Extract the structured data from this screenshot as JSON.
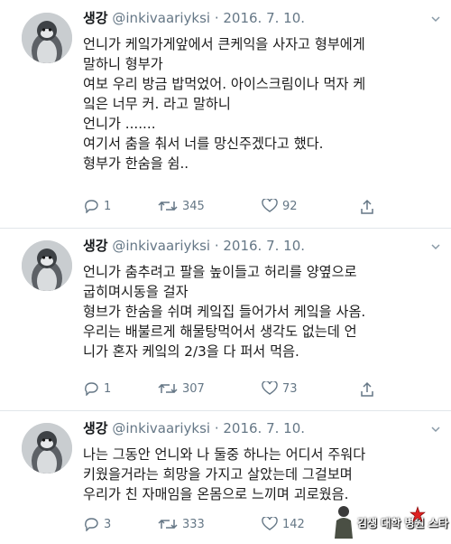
{
  "tweets": [
    {
      "name": "생강",
      "handle": "@inkivaariyksi",
      "date": "· 2016. 7. 10.",
      "lines": [
        "언니가 케잌가게앞에서 큰케익을 사자고 형부에게",
        "말하니 형부가",
        "여보 우리 방금 밥먹었어. 아이스크림이나 먹자 케",
        "잌은 너무 커. 라고 말하니",
        "언니가 .......",
        "여기서 춤을 춰서 너를 망신주겠다고 했다.",
        "형부가 한숨을 쉼.."
      ],
      "replies": "1",
      "retweets": "345",
      "likes": "92"
    },
    {
      "name": "생강",
      "handle": "@inkivaariyksi",
      "date": "· 2016. 7. 10.",
      "lines": [
        "언니가 춤추려고  팔을 높이들고 허리를 양옆으로",
        "굽히며시동을 걸자",
        "형브가 한숨을 쉬며 케잌집 들어가서 케잌을 사옴.",
        "우리는 배불르게 해물탕먹어서 생각도 없는데 언",
        "니가 혼자 케잌의 2/3을 다 퍼서 먹음."
      ],
      "replies": "1",
      "retweets": "307",
      "likes": "73"
    },
    {
      "name": "생강",
      "handle": "@inkivaariyksi",
      "date": "· 2016. 7. 10.",
      "lines": [
        "나는 그동안 언니와 나 둘중 하나는 어디서 주워다",
        "키웠을거라는 희망을 가지고 살았는데  그걸보며",
        "우리가 친 자매임을 온몸으로 느끼며 괴로웠음."
      ],
      "replies": "3",
      "retweets": "333",
      "likes": "142"
    }
  ],
  "icons": [
    "reply-icon",
    "retweet-icon",
    "like-icon",
    "share-icon",
    "caret-down-icon"
  ],
  "colors": {
    "text": "#14171a",
    "secondary": "#657786",
    "divider": "#e1e6ea"
  },
  "watermark": {
    "text": "김생 대학 병원 스타"
  }
}
